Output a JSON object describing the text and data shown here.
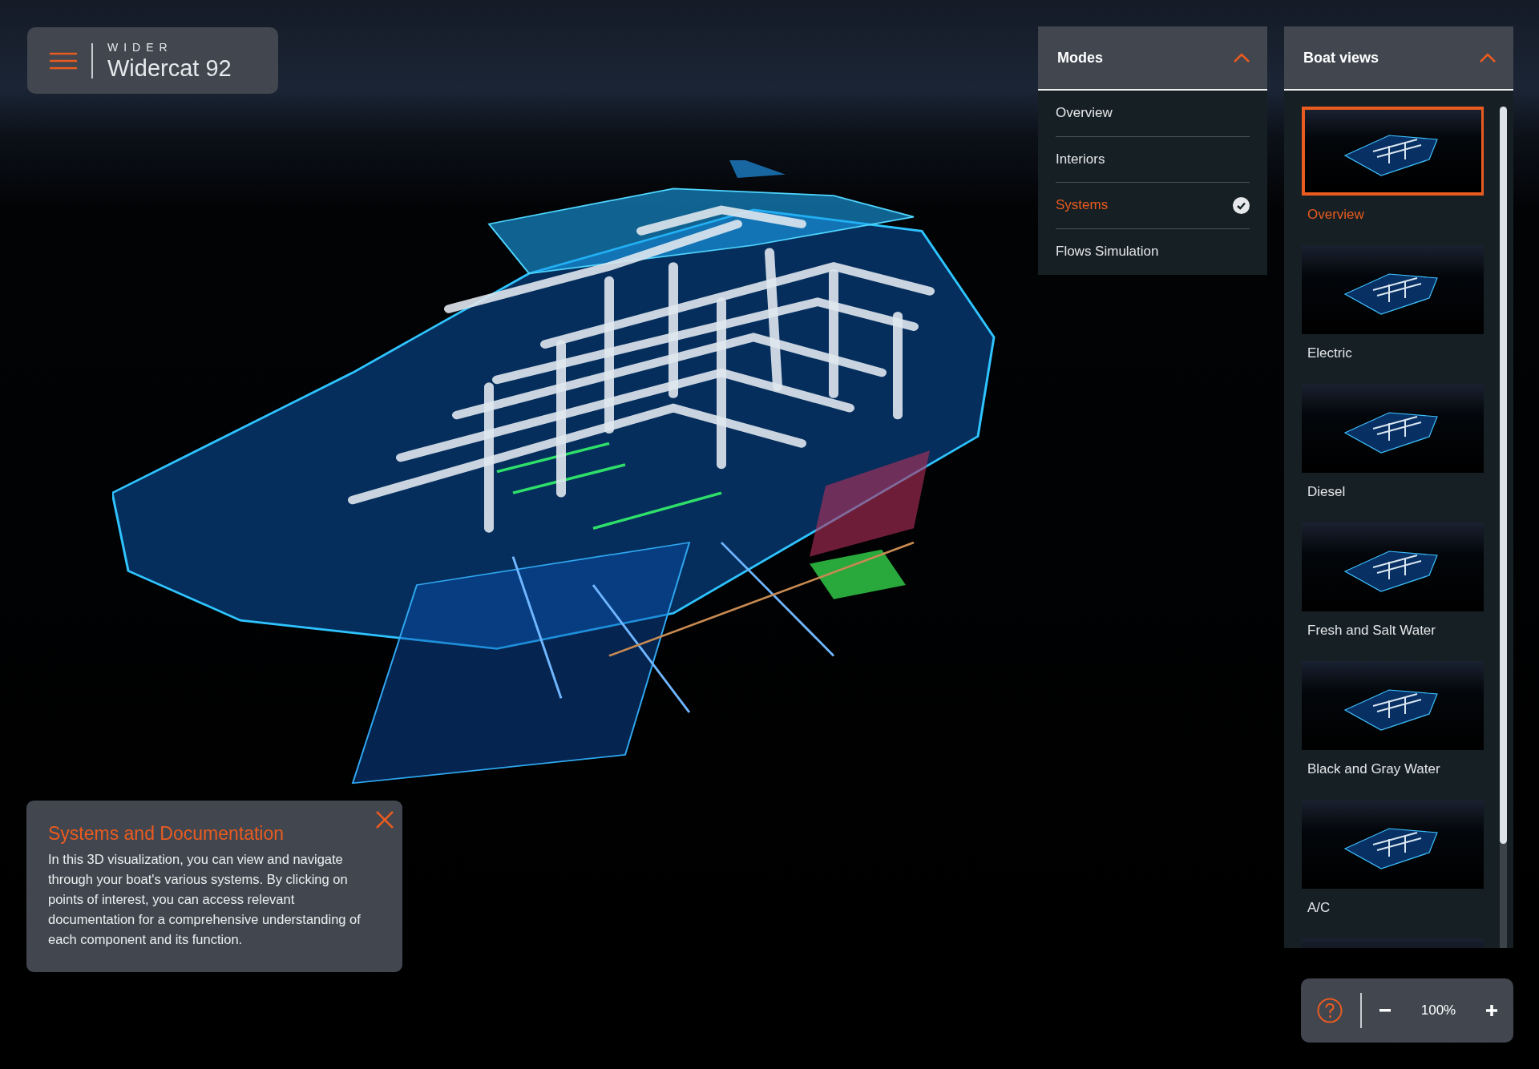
{
  "brand": {
    "wordmark": "WIDER",
    "model": "Widercat 92"
  },
  "modes": {
    "title": "Modes",
    "expanded": true,
    "items": [
      {
        "label": "Overview",
        "selected": false
      },
      {
        "label": "Interiors",
        "selected": false
      },
      {
        "label": "Systems",
        "selected": true
      },
      {
        "label": "Flows Simulation",
        "selected": false
      }
    ]
  },
  "boat_views": {
    "title": "Boat views",
    "expanded": true,
    "items": [
      {
        "label": "Overview",
        "selected": true
      },
      {
        "label": "Electric",
        "selected": false
      },
      {
        "label": "Diesel",
        "selected": false
      },
      {
        "label": "Fresh and Salt Water",
        "selected": false
      },
      {
        "label": "Black and Gray Water",
        "selected": false
      },
      {
        "label": "A/C",
        "selected": false
      },
      {
        "selected": false
      }
    ]
  },
  "info": {
    "title": "Systems and Documentation",
    "body": "In this 3D visualization, you can view and navigate through your boat's various systems. By clicking on points of interest, you can access relevant documentation for a comprehensive understanding of each component and its function."
  },
  "zoom": {
    "value": "100%"
  }
}
